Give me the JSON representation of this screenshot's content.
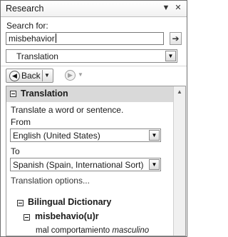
{
  "panel": {
    "title": "Research",
    "menu_glyph": "▼",
    "close_glyph": "✕"
  },
  "search": {
    "label": "Search for:",
    "value": "misbehavior",
    "go_glyph": "➔"
  },
  "source": {
    "selected": "Translation"
  },
  "nav": {
    "back_label": "Back"
  },
  "translation": {
    "header": "Translation",
    "intro": "Translate a word or sentence.",
    "from_label": "From",
    "from_value": "English (United States)",
    "to_label": "To",
    "to_value": "Spanish (Spain, International Sort)",
    "options_link": "Translation options..."
  },
  "dictionary": {
    "header": "Bilingual Dictionary",
    "entry": "misbehavio(u)r",
    "definition_text": "mal comportamiento ",
    "definition_gender": "masculino"
  },
  "icons": {
    "back": "back-arrow-icon",
    "forward": "forward-arrow-icon",
    "go": "go-arrow-icon",
    "dropdown": "chevron-down-icon",
    "collapse": "collapse-box-icon"
  }
}
